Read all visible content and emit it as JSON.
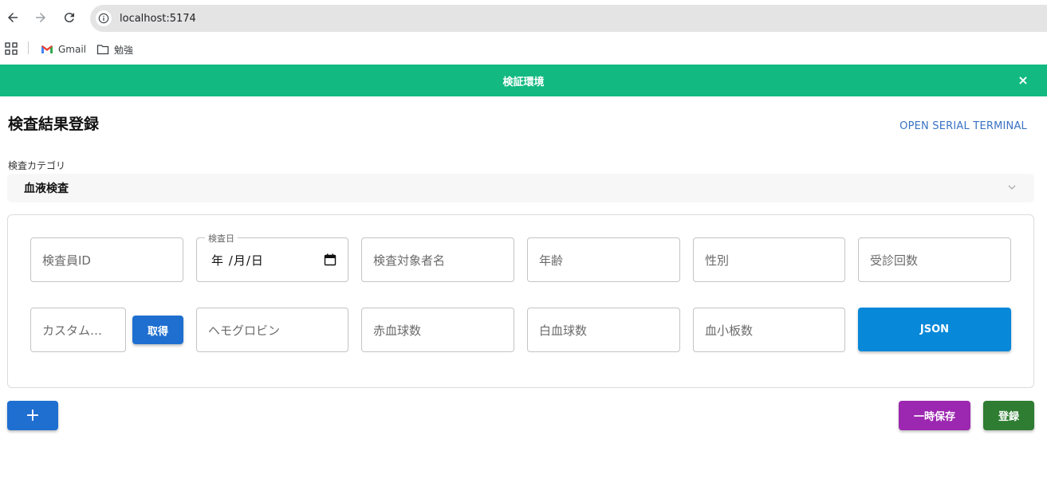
{
  "browser": {
    "url": "localhost:5174",
    "bookmarks": [
      {
        "label": "Gmail",
        "icon": "gmail-icon"
      },
      {
        "label": "勉強",
        "icon": "folder-icon"
      }
    ]
  },
  "banner": {
    "title": "検証環境",
    "close": "×",
    "color": "#12b981"
  },
  "page": {
    "title": "検査結果登録",
    "serial_link": "OPEN SERIAL TERMINAL"
  },
  "category": {
    "label": "検査カテゴリ",
    "value": "血液検査"
  },
  "form": {
    "row1": {
      "inspector_id": "検査員ID",
      "exam_date_label": "検査日",
      "exam_date_value": "年 /月/日",
      "subject_name": "検査対象者名",
      "age": "年齢",
      "gender": "性別",
      "visit_count": "受診回数"
    },
    "row2": {
      "custom": "カスタム…",
      "fetch_button": "取得",
      "hemoglobin": "ヘモグロビン",
      "rbc": "赤血球数",
      "wbc": "白血球数",
      "platelets": "血小板数",
      "json_button": "JSON"
    }
  },
  "actions": {
    "add": "+",
    "temp_save": "一時保存",
    "submit": "登録"
  }
}
